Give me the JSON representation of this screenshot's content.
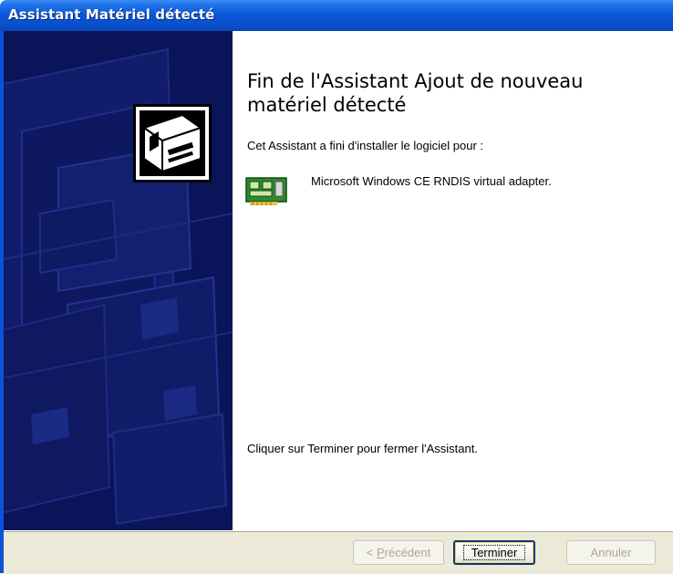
{
  "window": {
    "title": "Assistant Matériel détecté"
  },
  "content": {
    "heading": "Fin de l'Assistant Ajout de nouveau matériel détecté",
    "intro": "Cet Assistant a fini d'installer le logiciel pour :",
    "device_name": "Microsoft Windows CE RNDIS virtual adapter.",
    "finish_text": "Cliquer sur Terminer pour fermer l'Assistant."
  },
  "buttons": {
    "previous": {
      "prefix": "< ",
      "mnemonic": "P",
      "rest": "récédent",
      "enabled": false
    },
    "finish": {
      "label": "Terminer",
      "enabled": true
    },
    "cancel": {
      "label": "Annuler",
      "enabled": false
    }
  },
  "icons": {
    "wizard": "hardware-wizard-icon",
    "device": "network-card-icon"
  },
  "colors": {
    "titlebar": "#0857d9",
    "side_panel": "#0a1458",
    "bottom_bar": "#ece9d8"
  }
}
